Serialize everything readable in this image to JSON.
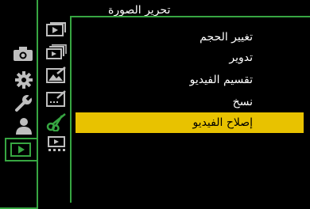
{
  "header": {
    "title": "تحرير الصورة"
  },
  "menu": {
    "items": [
      {
        "label": "تغيير الحجم",
        "selected": false
      },
      {
        "label": "تدوير",
        "selected": false
      },
      {
        "label": "تقسيم الفيديو",
        "selected": false
      },
      {
        "label": "نسخ",
        "selected": false
      },
      {
        "label": "إصلاح الفيديو",
        "selected": true
      }
    ]
  },
  "sidebar": {
    "tabs": [
      {
        "name": "camera-icon"
      },
      {
        "name": "gear-icon"
      },
      {
        "name": "wrench-icon"
      },
      {
        "name": "person-icon"
      },
      {
        "name": "playback-icon",
        "active": true
      }
    ],
    "sub_icons": [
      {
        "name": "playback-stack-icon"
      },
      {
        "name": "playback-stack-double-icon"
      },
      {
        "name": "image-edit-icon"
      },
      {
        "name": "text-edit-icon"
      },
      {
        "name": "scissors-icon",
        "active": true
      },
      {
        "name": "video-list-icon"
      }
    ]
  },
  "colors": {
    "accent_green": "#37a642",
    "selection_yellow": "#e8c200",
    "background": "#000000"
  }
}
